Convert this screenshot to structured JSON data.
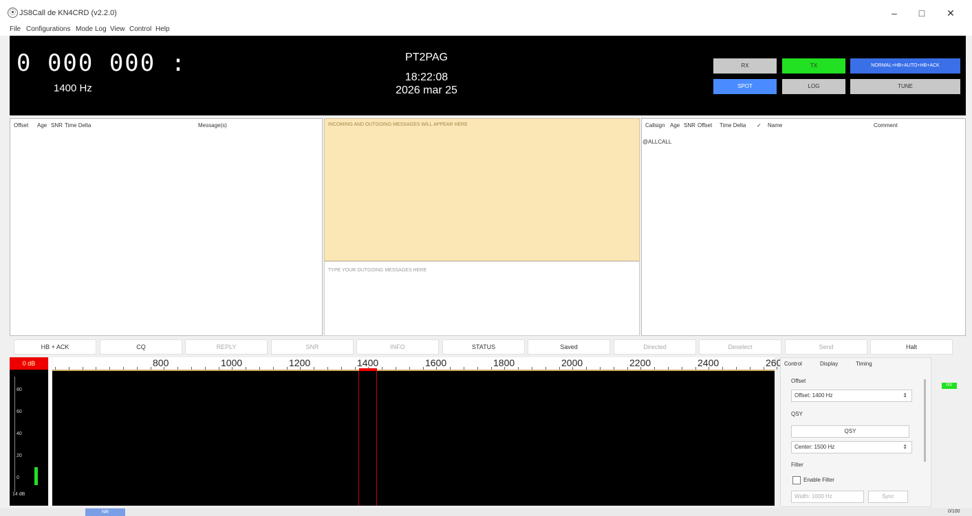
{
  "window": {
    "title": "JS8Call de KN4CRD (v2.2.0)",
    "app_icon": "app-logo-icon",
    "controls": {
      "minimize": "–",
      "maximize": "□",
      "close": "✕"
    }
  },
  "menu": [
    "File",
    "Configurations",
    "Mode",
    "Log",
    "View",
    "Control",
    "Help"
  ],
  "header": {
    "frequency": "0 000 000 :",
    "audio_offset": "1400 Hz",
    "callsign": "PT2PAG",
    "utc_time": "18:22:08",
    "utc_date": "2026 mar 25",
    "buttons": {
      "rx": "RX",
      "tx": "TX",
      "modes": "NORMAL+HB+AUTO+HB+ACK",
      "spot": "SPOT",
      "log": "LOG",
      "tune": "TUNE"
    },
    "colors": {
      "tx": "#22e022",
      "spot": "#4a8cff",
      "modes": "#3a6fe8",
      "gray": "#c8c8c8"
    }
  },
  "activity": {
    "columns": [
      "Offset",
      "Age",
      "SNR",
      "Time Delta",
      "Message(s)"
    ]
  },
  "inbox": {
    "placeholder": "INCOMING AND OUTGOING MESSAGES WILL APPEAR HERE"
  },
  "outbox": {
    "placeholder": "TYPE YOUR OUTGOING MESSAGES HERE"
  },
  "calls": {
    "columns": [
      "Callsign",
      "Age",
      "SNR",
      "Offset",
      "Time Delta",
      "✓",
      "Name",
      "Comment"
    ],
    "rows": [
      "@ALLCALL"
    ]
  },
  "quick_buttons": [
    "HB + ACK",
    "CQ",
    "REPLY",
    "SNR",
    "INFO",
    "STATUS",
    "Saved",
    "Directed",
    "Deselect",
    "Send",
    "Halt"
  ],
  "quick_buttons_enabled": [
    true,
    true,
    false,
    false,
    false,
    true,
    true,
    false,
    false,
    false,
    true
  ],
  "waterfall": {
    "scale_label": "0 dB",
    "ruler_ticks": [
      "800",
      "1000",
      "1200",
      "1400",
      "1600",
      "1800",
      "2000",
      "2200",
      "2400",
      "260"
    ],
    "scale_ticks": [
      "80",
      "60",
      "40",
      "20",
      "0"
    ],
    "bottom_label": "14 dB",
    "marker_hz": 1400
  },
  "side": {
    "tabs": [
      "Control",
      "Display",
      "Timing"
    ],
    "offset_label": "Offset",
    "offset_value": "Offset: 1400 Hz",
    "qsy_label": "QSY",
    "qsy_button": "QSY",
    "center_value": "Center: 1500 Hz",
    "filter_label": "Filter",
    "enable_filter": "Enable Filter",
    "width_value": "Width: 1000 Hz",
    "sync_button": "Sync",
    "meter_label": "RX"
  },
  "status": {
    "mode": "NR",
    "clock": "0/100"
  }
}
